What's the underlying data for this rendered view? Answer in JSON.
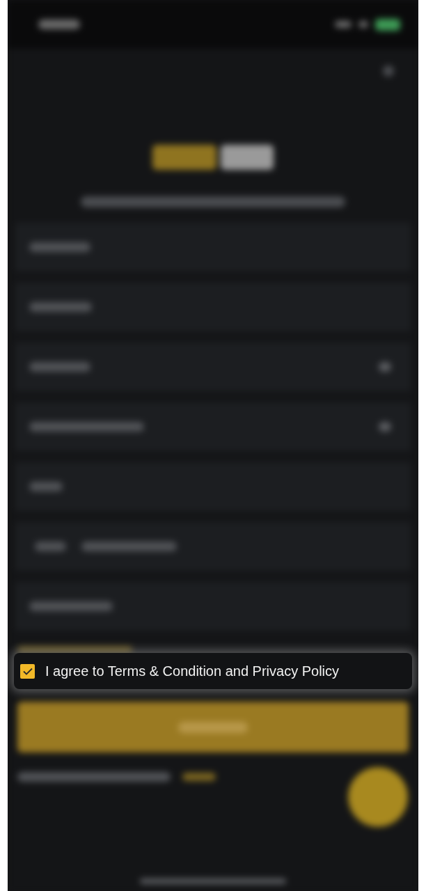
{
  "agreement": {
    "checked": true,
    "label": "I agree to Terms & Condition and Privacy Policy"
  }
}
